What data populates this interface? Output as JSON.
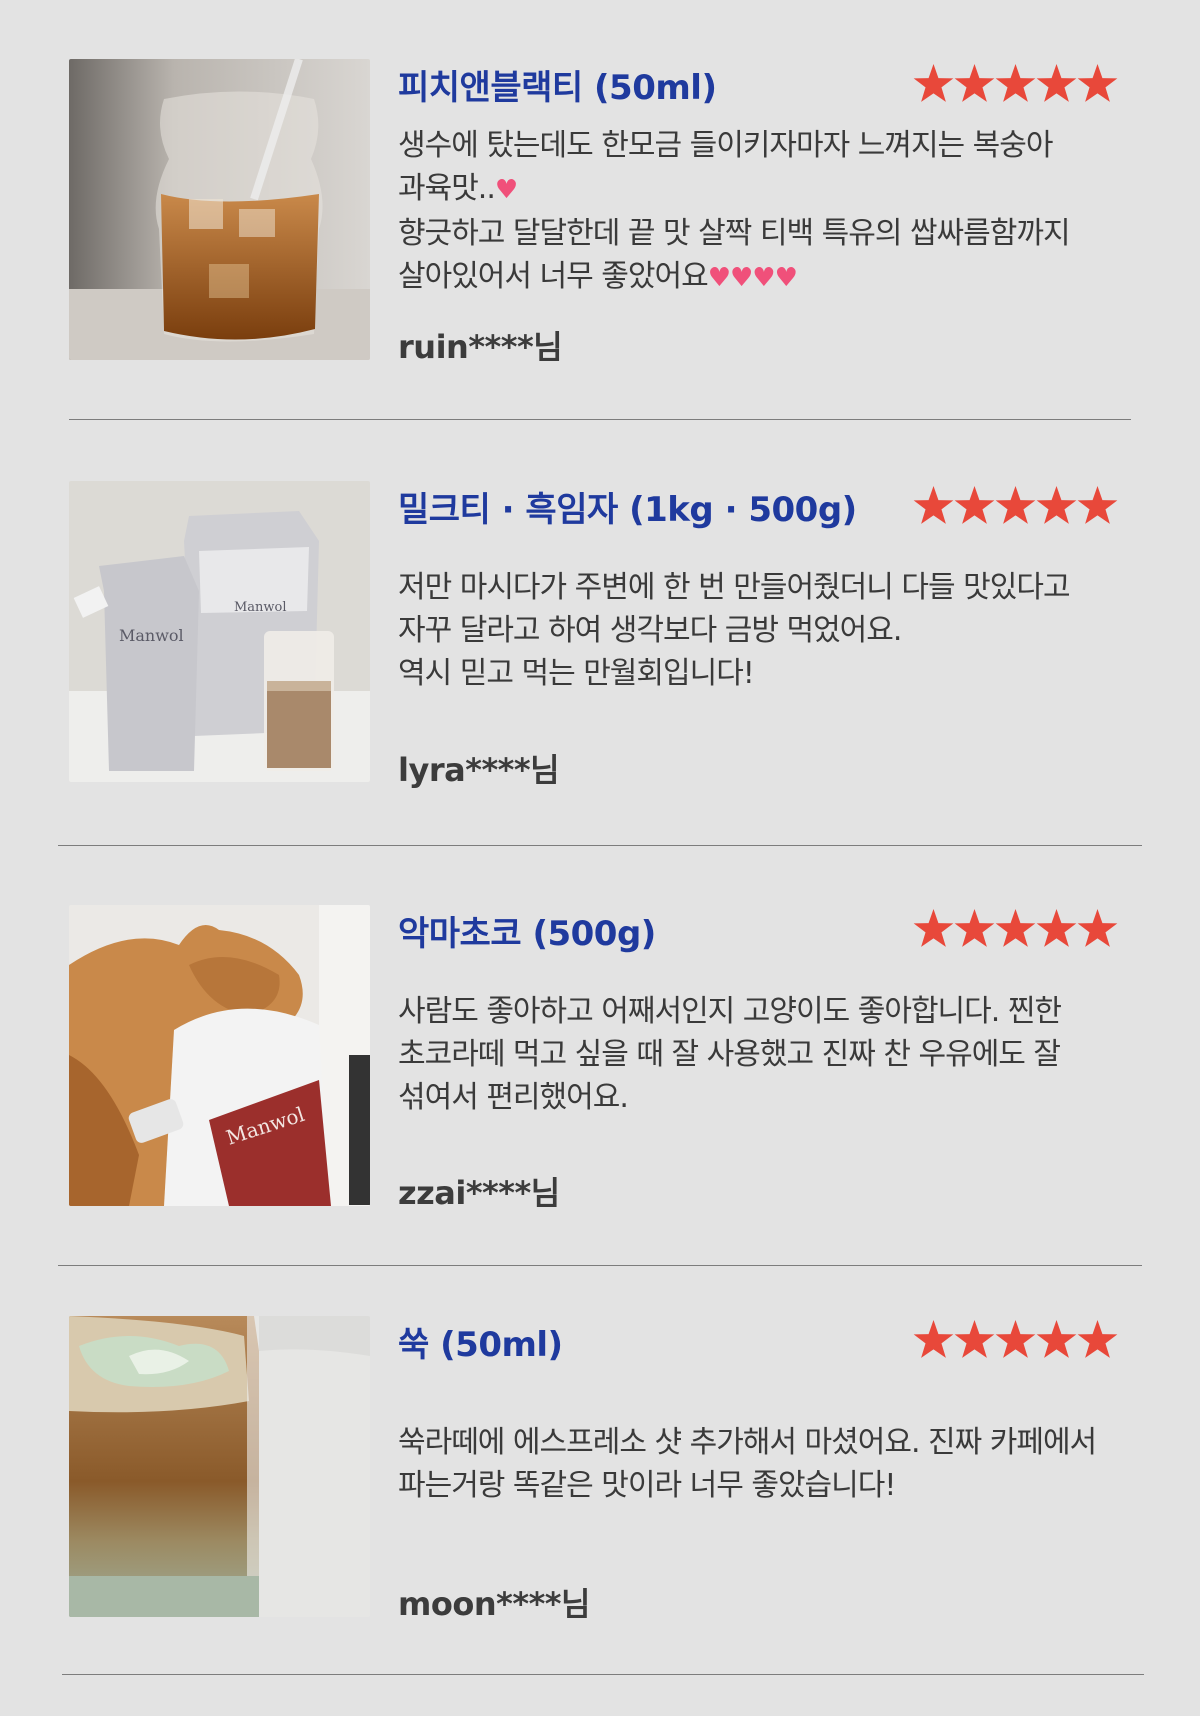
{
  "colors": {
    "background": "#e3e3e3",
    "title": "#1f3a9e",
    "star": "#e8483a",
    "heart": "#f0507a",
    "text": "#3a3a3a"
  },
  "reviews": [
    {
      "product": "피치앤블랙티 (50ml)",
      "rating": 5,
      "lines": [
        [
          "생수에 탔는데도 한모금 들이키자마자 느껴지는 복숭아"
        ],
        [
          "과육맛..",
          "♥"
        ],
        [
          "향긋하고 달달한데 끝 맛 살짝 티백 특유의 쌉싸름함까지"
        ],
        [
          "살아있어서 너무 좋았어요",
          "♥♥♥♥"
        ]
      ],
      "author": "ruin****님",
      "photo": "iced-peach-tea-glass"
    },
    {
      "product": "밀크티 · 흑임자 (1kg · 500g)",
      "rating": 5,
      "lines": [
        [
          "저만 마시다가 주변에 한 번 만들어줬더니 다들 맛있다고"
        ],
        [
          "자꾸 달라고 하여 생각보다 금방 먹었어요."
        ],
        [
          "역시 믿고 먹는 만월회입니다!"
        ]
      ],
      "author": "lyra****님",
      "photo": "manwol-pouches-with-milk-tea"
    },
    {
      "product": "악마초코 (500g)",
      "rating": 5,
      "lines": [
        [
          "사람도 좋아하고 어째서인지 고양이도 좋아합니다. 찐한"
        ],
        [
          "초코라떼 먹고 싶을 때 잘 사용했고 진짜 찬 우유에도 잘"
        ],
        [
          "섞여서 편리했어요."
        ]
      ],
      "author": "zzai****님",
      "photo": "cat-with-manwol-pouch"
    },
    {
      "product": "쑥 (50ml)",
      "rating": 5,
      "lines": [
        [
          "쑥라떼에 에스프레소 샷 추가해서 마셨어요. 진짜 카페에서"
        ],
        [
          "파는거랑 똑같은 맛이라 너무 좋았습니다!"
        ]
      ],
      "author": "moon****님",
      "photo": "mugwort-latte-glass"
    }
  ],
  "photo_labels": {
    "brand": "Manwol"
  }
}
